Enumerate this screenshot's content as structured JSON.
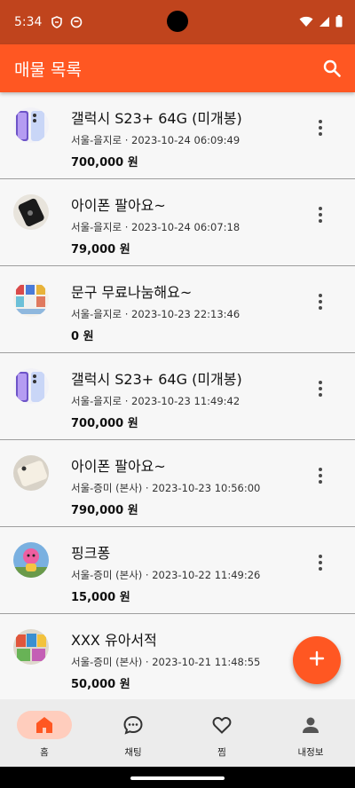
{
  "status_bar": {
    "time": "5:34"
  },
  "app_bar": {
    "title": "매물 목록",
    "search_icon": "search-icon"
  },
  "colors": {
    "accent": "#ff5722",
    "status_bar": "#c0441d",
    "active_pill": "#ffcdbd"
  },
  "items": [
    {
      "title": "갤럭시 S23+ 64G (미개봉)",
      "meta": "서울-을지로 · 2023-10-24 06:09:49",
      "price": "700,000 원",
      "thumb": "phone-purple"
    },
    {
      "title": "아이폰 팔아요~",
      "meta": "서울-을지로 · 2023-10-24 06:07:18",
      "price": "79,000 원",
      "thumb": "phone-black"
    },
    {
      "title": "문구 무료나눔해요~",
      "meta": "서울-을지로 · 2023-10-23 22:13:46",
      "price": "0 원",
      "thumb": "stationery"
    },
    {
      "title": "갤럭시 S23+ 64G (미개봉)",
      "meta": "서울-을지로 · 2023-10-23 11:49:42",
      "price": "700,000 원",
      "thumb": "phone-purple"
    },
    {
      "title": "아이폰 팔아요~",
      "meta": "서울-증미 (본사) · 2023-10-23 10:56:00",
      "price": "790,000 원",
      "thumb": "phone-white"
    },
    {
      "title": "핑크퐁",
      "meta": "서울-증미 (본사) · 2023-10-22 11:49:26",
      "price": "15,000 원",
      "thumb": "toy-pink"
    },
    {
      "title": "XXX 유아서적",
      "meta": "서울-증미 (본사) · 2023-10-21 11:48:55",
      "price": "50,000 원",
      "thumb": "books"
    }
  ],
  "fab": {
    "icon": "plus-icon"
  },
  "bottom_nav": [
    {
      "label": "홈",
      "icon": "home-icon",
      "active": true
    },
    {
      "label": "채팅",
      "icon": "chat-icon",
      "active": false
    },
    {
      "label": "찜",
      "icon": "heart-icon",
      "active": false
    },
    {
      "label": "내정보",
      "icon": "person-icon",
      "active": false
    }
  ]
}
